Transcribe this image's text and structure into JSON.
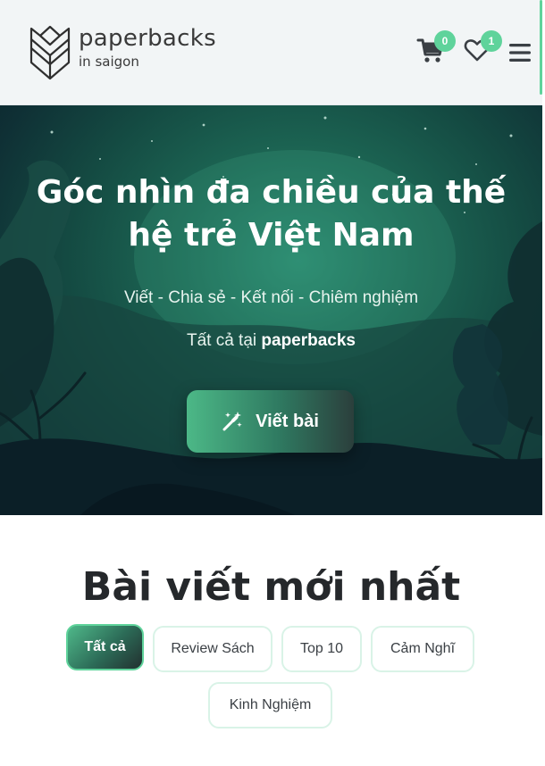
{
  "header": {
    "logo_title": "paperbacks",
    "logo_subtitle": "in saigon",
    "cart_count": "0",
    "wishlist_count": "1"
  },
  "hero": {
    "title": "Góc nhìn đa chiều của thế hệ trẻ Việt Nam",
    "tagline": "Viết - Chia sẻ - Kết nối - Chiêm nghiệm",
    "sub_prefix": "Tất cả tại ",
    "sub_brand": "paperbacks",
    "write_button": "Viết bài"
  },
  "section": {
    "title": "Bài viết mới nhất",
    "filters": [
      "Tất cả",
      "Review Sách",
      "Top 10",
      "Cảm Nghĩ",
      "Kinh Nghiệm"
    ],
    "active_filter": "Tất cả"
  },
  "colors": {
    "accent": "#5fd39b",
    "header_bg": "#f2f5f6",
    "hero_dark": "#0b1f27"
  },
  "icons": [
    "logo-book-icon",
    "cart-icon",
    "heart-icon",
    "hamburger-menu-icon",
    "magic-wand-icon"
  ]
}
